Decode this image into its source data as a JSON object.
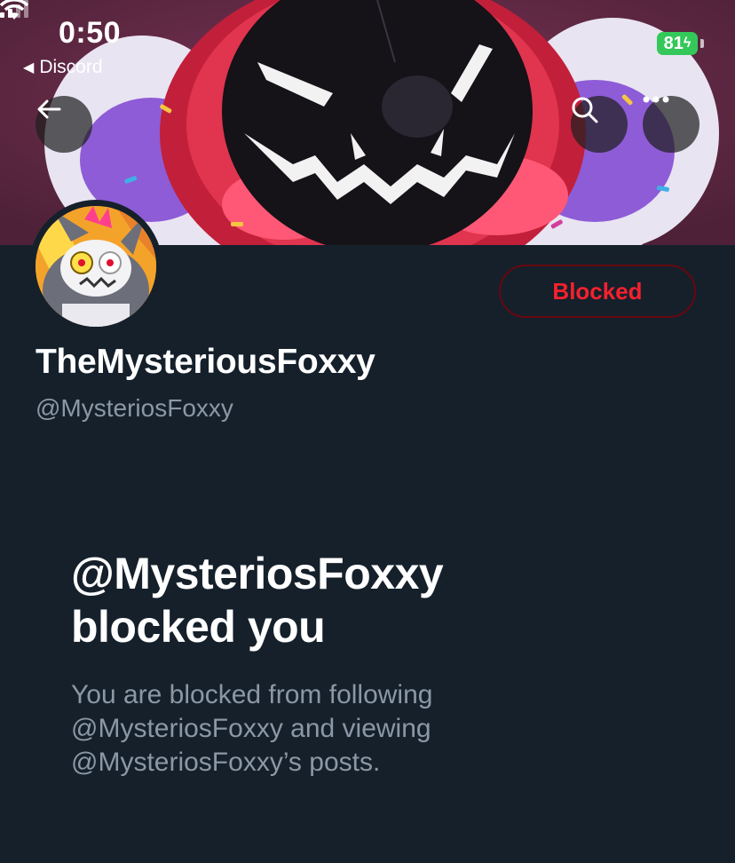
{
  "status_bar": {
    "time": "0:50",
    "back_app": "Discord",
    "battery": "81"
  },
  "header": {
    "icons": {
      "back": "arrow-left-icon",
      "search": "search-icon",
      "more": "more-horizontal-icon"
    }
  },
  "profile": {
    "display_name": "TheMysteriousFoxxy",
    "handle": "@MysteriosFoxxy",
    "blocked_button_label": "Blocked"
  },
  "blocked_notice": {
    "title_line1": "@MysteriosFoxxy",
    "title_line2": "blocked you",
    "desc_line1": "You are blocked from following",
    "desc_line2": "@MysteriosFoxxy and viewing",
    "desc_line3": "@MysteriosFoxxy’s posts."
  },
  "colors": {
    "background": "#15202b",
    "blocked_red": "#f4212e",
    "secondary_text": "#8b98a5",
    "battery_green": "#34c759"
  }
}
